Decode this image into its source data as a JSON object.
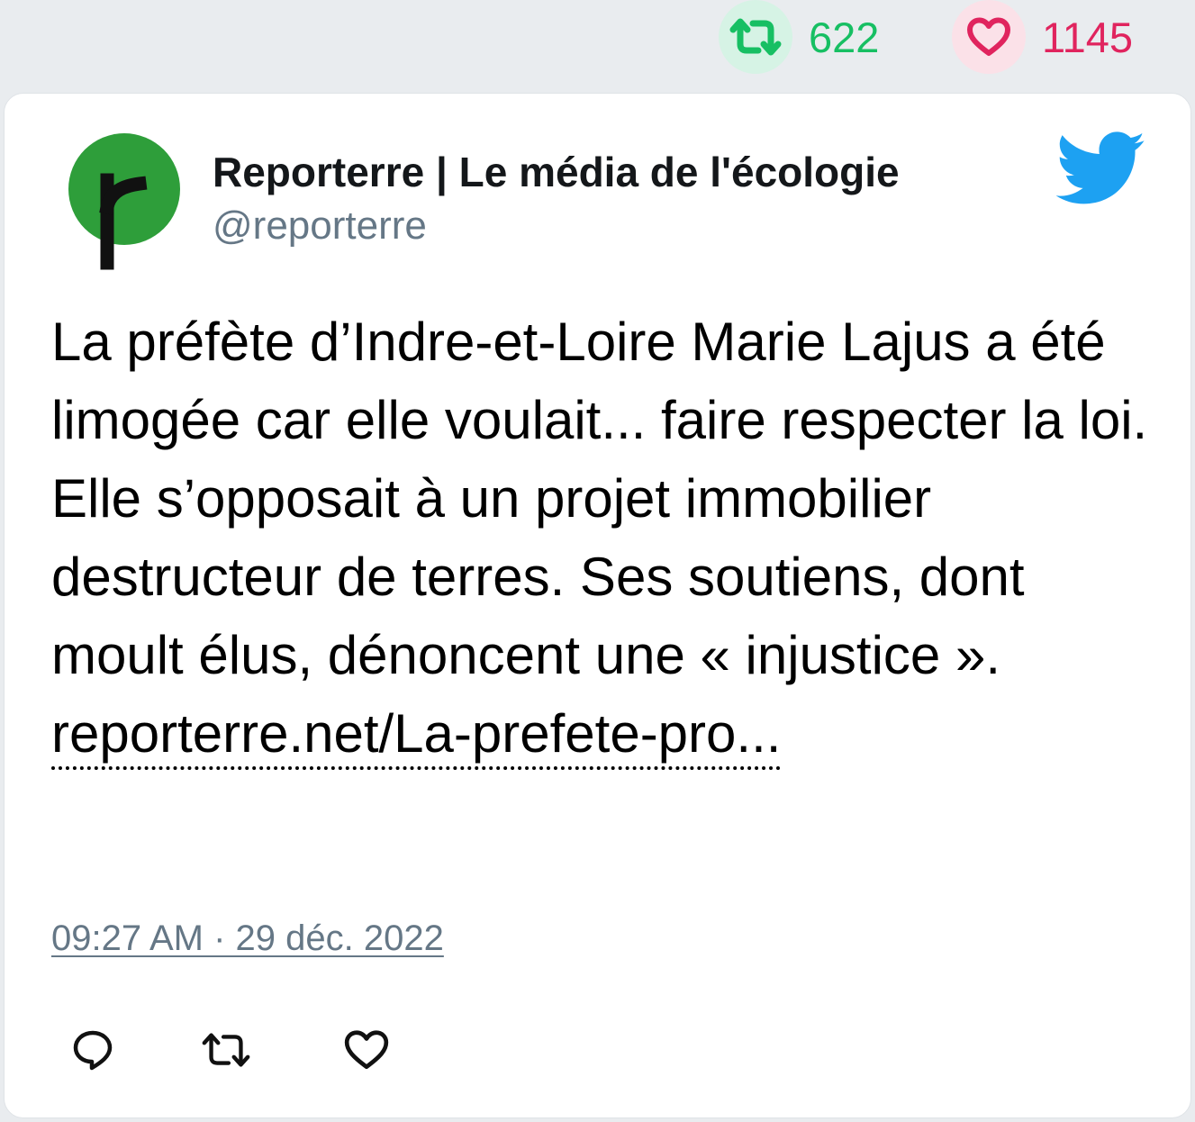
{
  "stats": {
    "retweet_count": "622",
    "like_count": "1145",
    "retweet_color": "#17bf63",
    "like_color": "#e0245e"
  },
  "tweet": {
    "author_name": "Reporterre | Le média de l'écologie",
    "author_handle": "@reporterre",
    "text": "La préfète d’Indre-et-Loire Marie Lajus a été limogée car elle voulait... faire respecter la loi. Elle s’opposait à un projet immobilier destructeur de terres. Ses soutiens, dont moult élus, dénoncent une « injustice ».",
    "link_text": "reporterre.net/La-prefete-pro...",
    "timestamp": "09:27 AM · 29 déc. 2022",
    "avatar_letter": "r"
  },
  "icons": {
    "retweet_stat": "retweet-icon",
    "like_stat": "heart-icon",
    "brand": "twitter-bird-icon",
    "reply_action": "reply-icon",
    "retweet_action": "retweet-icon",
    "like_action": "heart-icon"
  },
  "colors": {
    "twitter_blue": "#1da1f2",
    "avatar_green": "#2e9e3a",
    "muted_text": "#657786"
  }
}
